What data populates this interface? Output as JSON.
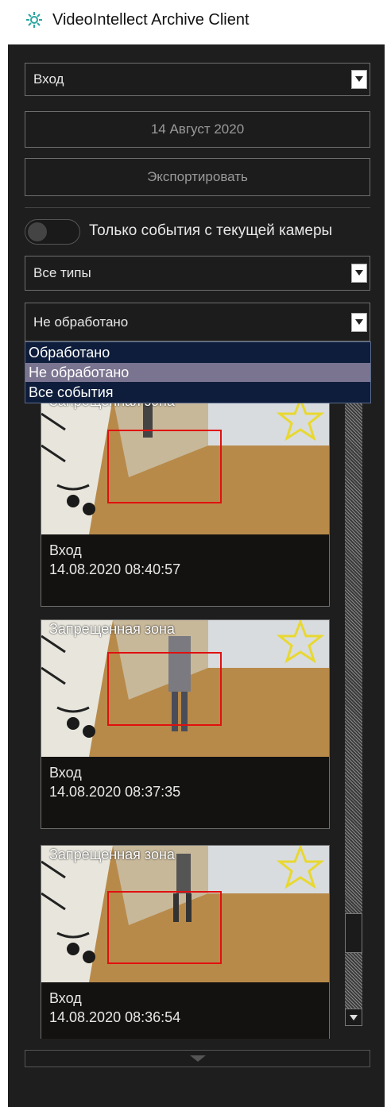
{
  "window": {
    "title": "VideoIntellect Archive Client",
    "icon": "gear-flower-icon"
  },
  "camera_select": {
    "value": "Вход"
  },
  "date_field": {
    "value": "14 Август 2020"
  },
  "export_button": {
    "label": "Экспортировать"
  },
  "current_camera_toggle": {
    "label": "Только события с текущей камеры",
    "on": false
  },
  "type_select": {
    "value": "Все типы"
  },
  "status_select": {
    "value": "Не обработано",
    "open": true,
    "options": [
      "Обработано",
      "Не обработано",
      "Все события"
    ],
    "selected_index": 1
  },
  "events": [
    {
      "type": "Запрещенная зона",
      "camera": "Вход",
      "timestamp": "14.08.2020 08:40:57",
      "starred": true
    },
    {
      "type": "Запрещенная зона",
      "camera": "Вход",
      "timestamp": "14.08.2020 08:37:35",
      "starred": true
    },
    {
      "type": "Запрещенная зона",
      "camera": "Вход",
      "timestamp": "14.08.2020 08:36:54",
      "starred": true
    }
  ],
  "colors": {
    "panel_bg": "#1e1e1e",
    "dropdown_bg": "#0e1d3b",
    "dropdown_selected": "#7a7490",
    "detection_box": "#e01010",
    "star": "#e8d830"
  }
}
